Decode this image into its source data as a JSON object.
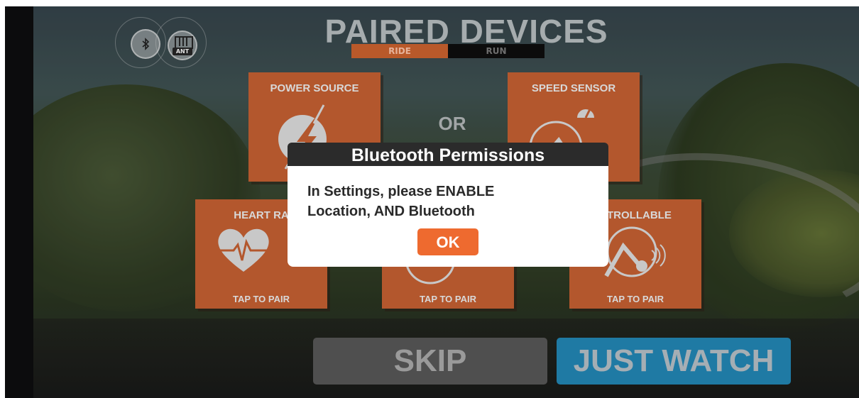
{
  "header": {
    "title": "PAIRED DEVICES",
    "tabs": [
      {
        "label": "RIDE",
        "selected": true
      },
      {
        "label": "RUN",
        "selected": false
      }
    ],
    "connection_icons": [
      "bluetooth-icon",
      "ant-icon"
    ],
    "ant_label": "ANT"
  },
  "tiles": {
    "power_source": {
      "label": "POWER SOURCE",
      "icon": "power-bolt-icon"
    },
    "speed_sensor": {
      "label": "SPEED SENSOR",
      "icon": "speed-sensor-icon"
    },
    "heart_rate": {
      "label": "HEART RA",
      "foot": "TAP TO PAIR",
      "icon": "heart-rate-icon"
    },
    "cadence": {
      "foot": "TAP TO PAIR",
      "icon": "cadence-icon"
    },
    "controllable": {
      "label": "NTROLLABLE",
      "foot": "TAP TO PAIR",
      "icon": "controllable-trainer-icon"
    },
    "separator": "OR"
  },
  "footer": {
    "skip_label": "SKIP",
    "watch_label": "JUST WATCH"
  },
  "dialog": {
    "title": "Bluetooth Permissions",
    "message": "In Settings, please ENABLE\nLocation, AND Bluetooth",
    "ok_label": "OK"
  },
  "colors": {
    "tile": "#b3572d",
    "ride_tab": "#b9592a",
    "ok_button": "#ee6a2f",
    "just_watch": "#1f7aa4",
    "skip": "#4f4f4f",
    "dialog_header": "#2b2b2b"
  }
}
